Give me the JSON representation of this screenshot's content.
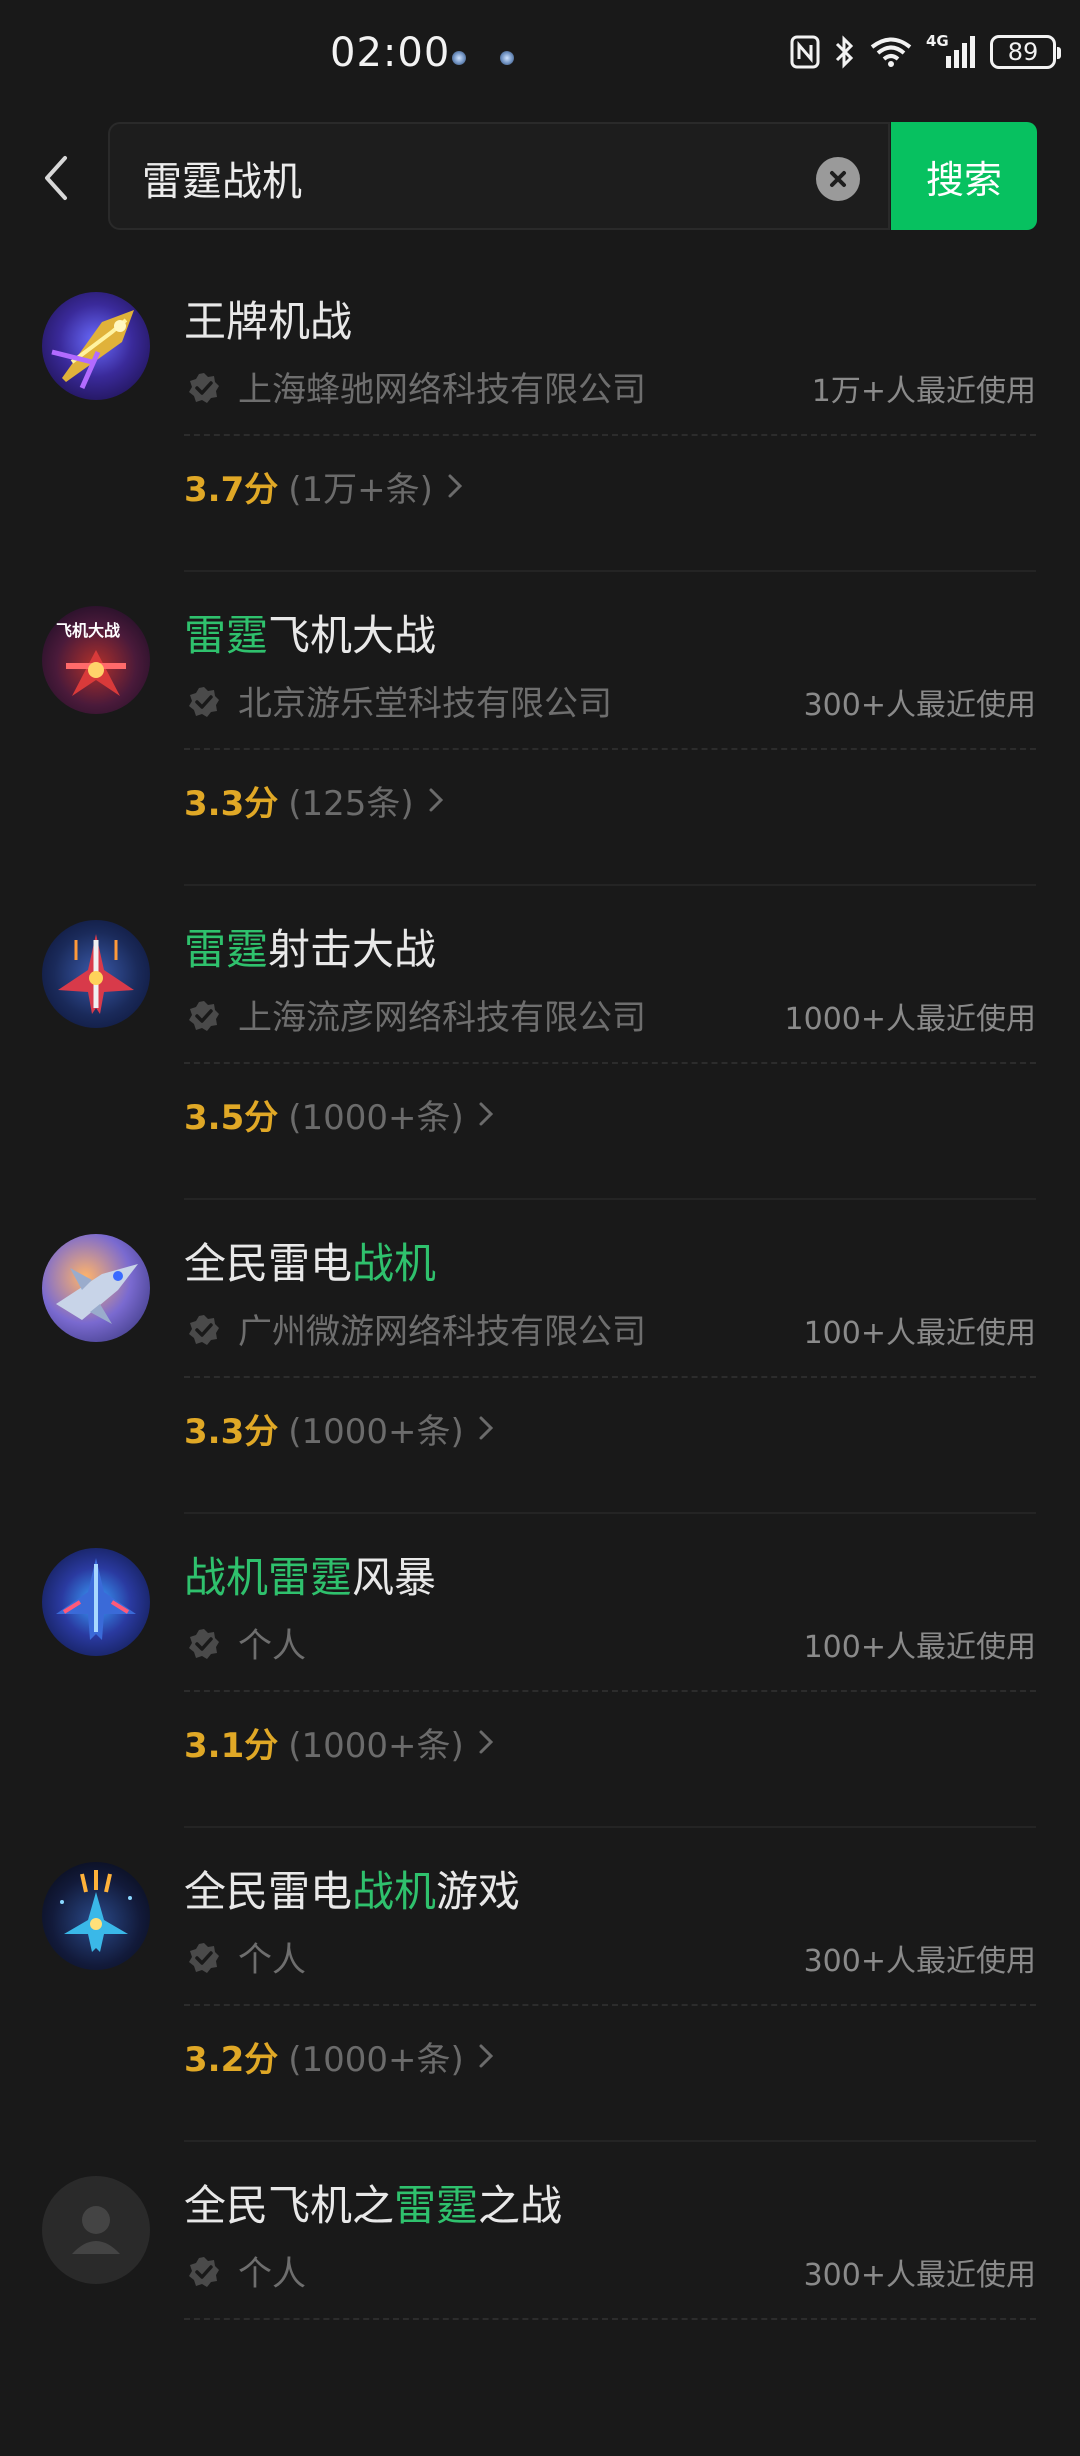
{
  "status_bar": {
    "time": "02:00",
    "icons": [
      "nfc-icon",
      "bluetooth-icon",
      "wifi-icon",
      "signal-4g-icon"
    ],
    "network_label": "4G",
    "battery": "89"
  },
  "search": {
    "query": "雷霆战机",
    "button_label": "搜索"
  },
  "colors": {
    "background": "#191919",
    "highlight": "#2fc16d",
    "score": "#e0a826",
    "search_button": "#07c160"
  },
  "results": [
    {
      "name_parts": [
        {
          "t": "王牌机战",
          "hl": false
        }
      ],
      "company": "上海蜂驰网络科技有限公司",
      "usage": "1万+人最近使用",
      "score": "3.7分",
      "reviews": "(1万+条)",
      "icon": "fighter-jet-golden-icon"
    },
    {
      "name_parts": [
        {
          "t": "雷霆",
          "hl": true
        },
        {
          "t": "飞机大战",
          "hl": false
        }
      ],
      "company": "北京游乐堂科技有限公司",
      "usage": "300+人最近使用",
      "score": "3.3分",
      "reviews": "(125条)",
      "icon": "fighter-jet-logo-icon"
    },
    {
      "name_parts": [
        {
          "t": "雷霆",
          "hl": true
        },
        {
          "t": "射击大战",
          "hl": false
        }
      ],
      "company": "上海流彦网络科技有限公司",
      "usage": "1000+人最近使用",
      "score": "3.5分",
      "reviews": "(1000+条)",
      "icon": "red-fighter-jet-icon"
    },
    {
      "name_parts": [
        {
          "t": "全民雷电",
          "hl": false
        },
        {
          "t": "战机",
          "hl": true
        }
      ],
      "company": "广州微游网络科技有限公司",
      "usage": "100+人最近使用",
      "score": "3.3分",
      "reviews": "(1000+条)",
      "icon": "silver-fighter-jet-icon"
    },
    {
      "name_parts": [
        {
          "t": "战机",
          "hl": true
        },
        {
          "t": "雷霆",
          "hl": true
        },
        {
          "t": "风暴",
          "hl": false
        }
      ],
      "company": "个人",
      "usage": "100+人最近使用",
      "score": "3.1分",
      "reviews": "(1000+条)",
      "icon": "blue-fighter-jet-icon"
    },
    {
      "name_parts": [
        {
          "t": "全民雷电",
          "hl": false
        },
        {
          "t": "战机",
          "hl": true
        },
        {
          "t": "游戏",
          "hl": false
        }
      ],
      "company": "个人",
      "usage": "300+人最近使用",
      "score": "3.2分",
      "reviews": "(1000+条)",
      "icon": "space-fighter-jet-icon"
    },
    {
      "name_parts": [
        {
          "t": "全民飞机之",
          "hl": false
        },
        {
          "t": "雷霆",
          "hl": true
        },
        {
          "t": "之战",
          "hl": false
        }
      ],
      "company": "个人",
      "usage": "300+人最近使用",
      "score": "",
      "reviews": "",
      "icon": "default-avatar-icon"
    }
  ]
}
